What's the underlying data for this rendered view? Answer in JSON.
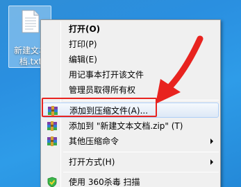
{
  "desktop": {
    "icon_label": "新建文本\n档.txt",
    "icon_name": "text-file-icon"
  },
  "menu": {
    "items": [
      {
        "label": "打开(O)",
        "bold": true
      },
      {
        "label": "打印(P)"
      },
      {
        "label": "编辑(E)"
      },
      {
        "label": "用记事本打开该文件"
      },
      {
        "label": "管理员取得所有权"
      },
      {
        "label": "添加到压缩文件(A)...",
        "icon": "winrar-icon",
        "highlighted": true
      },
      {
        "label": "添加到 \"新建文本文档.zip\" (T)",
        "icon": "winrar-icon"
      },
      {
        "label": "其他压缩命令",
        "icon": "winrar-icon",
        "submenu": true
      },
      {
        "label": "打开方式(H)",
        "submenu": true
      },
      {
        "label": "使用 360杀毒 扫描",
        "icon": "360-shield-icon"
      }
    ]
  },
  "annotation": {
    "color": "#e8231f"
  }
}
